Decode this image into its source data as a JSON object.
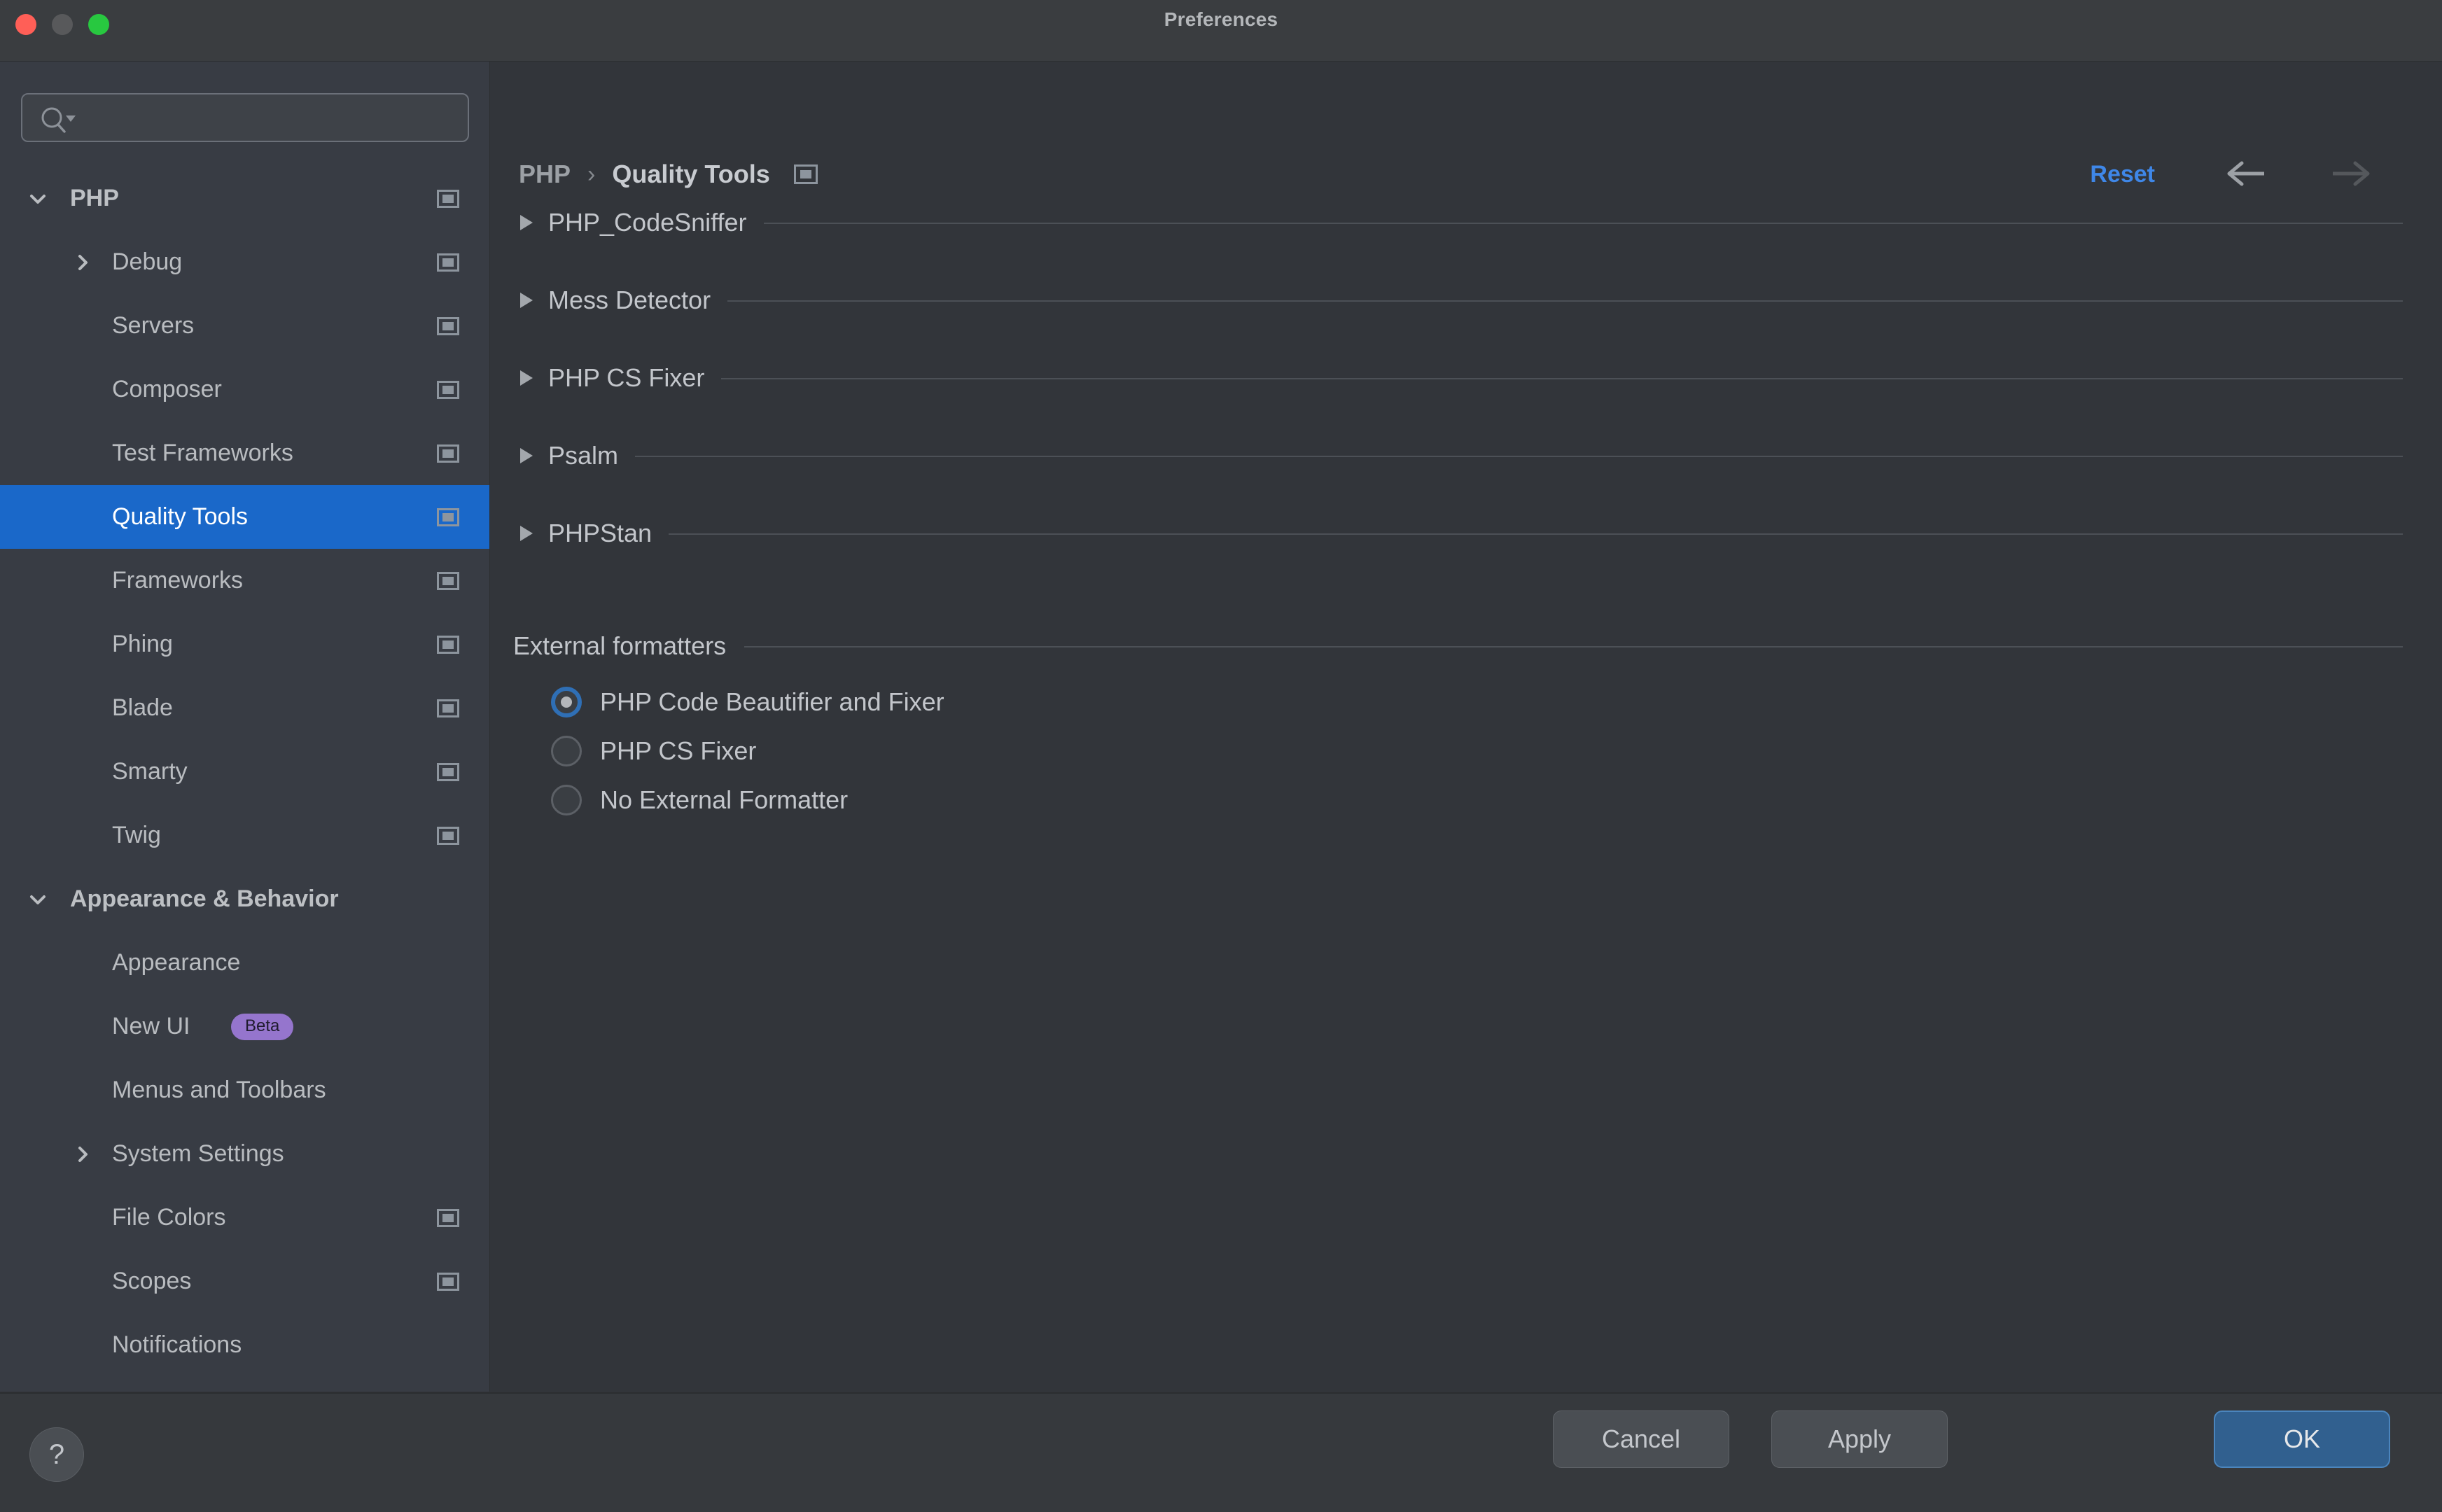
{
  "window": {
    "title": "Preferences",
    "traffic_lights": [
      "close-button",
      "minimize-button",
      "zoom-button"
    ]
  },
  "sidebar": {
    "search": {
      "value": "",
      "placeholder": "",
      "icon": "search-icon"
    },
    "items": [
      {
        "label": "PHP",
        "level": 0,
        "chevron": "chevron-down",
        "bold": true,
        "scope_icon": true,
        "selected": false
      },
      {
        "label": "Debug",
        "level": 1,
        "chevron": "chevron-right",
        "bold": false,
        "scope_icon": true,
        "selected": false
      },
      {
        "label": "Servers",
        "level": 1,
        "chevron": "none",
        "bold": false,
        "scope_icon": true,
        "selected": false
      },
      {
        "label": "Composer",
        "level": 1,
        "chevron": "none",
        "bold": false,
        "scope_icon": true,
        "selected": false
      },
      {
        "label": "Test Frameworks",
        "level": 1,
        "chevron": "none",
        "bold": false,
        "scope_icon": true,
        "selected": false
      },
      {
        "label": "Quality Tools",
        "level": 1,
        "chevron": "none",
        "bold": false,
        "scope_icon": true,
        "selected": true
      },
      {
        "label": "Frameworks",
        "level": 1,
        "chevron": "none",
        "bold": false,
        "scope_icon": true,
        "selected": false
      },
      {
        "label": "Phing",
        "level": 1,
        "chevron": "none",
        "bold": false,
        "scope_icon": true,
        "selected": false
      },
      {
        "label": "Blade",
        "level": 1,
        "chevron": "none",
        "bold": false,
        "scope_icon": true,
        "selected": false
      },
      {
        "label": "Smarty",
        "level": 1,
        "chevron": "none",
        "bold": false,
        "scope_icon": true,
        "selected": false
      },
      {
        "label": "Twig",
        "level": 1,
        "chevron": "none",
        "bold": false,
        "scope_icon": true,
        "selected": false
      },
      {
        "label": "Appearance & Behavior",
        "level": 0,
        "chevron": "chevron-down",
        "bold": true,
        "scope_icon": false,
        "selected": false
      },
      {
        "label": "Appearance",
        "level": 1,
        "chevron": "none",
        "bold": false,
        "scope_icon": false,
        "selected": false
      },
      {
        "label": "New UI",
        "level": 1,
        "chevron": "none",
        "bold": false,
        "scope_icon": false,
        "selected": false,
        "badge": "Beta"
      },
      {
        "label": "Menus and Toolbars",
        "level": 1,
        "chevron": "none",
        "bold": false,
        "scope_icon": false,
        "selected": false
      },
      {
        "label": "System Settings",
        "level": 1,
        "chevron": "chevron-right",
        "bold": false,
        "scope_icon": false,
        "selected": false
      },
      {
        "label": "File Colors",
        "level": 1,
        "chevron": "none",
        "bold": false,
        "scope_icon": true,
        "selected": false
      },
      {
        "label": "Scopes",
        "level": 1,
        "chevron": "none",
        "bold": false,
        "scope_icon": true,
        "selected": false
      },
      {
        "label": "Notifications",
        "level": 1,
        "chevron": "none",
        "bold": false,
        "scope_icon": false,
        "selected": false
      }
    ]
  },
  "header": {
    "breadcrumb_root": "PHP",
    "breadcrumb_separator": "›",
    "breadcrumb_current": "Quality Tools",
    "scope_icon": "project-scope-icon",
    "reset_label": "Reset",
    "back_icon": "arrow-left-icon",
    "forward_icon": "arrow-right-icon",
    "back_enabled": true,
    "forward_enabled": false
  },
  "main": {
    "sections": [
      {
        "label": "PHP_CodeSniffer",
        "expanded": false
      },
      {
        "label": "Mess Detector",
        "expanded": false
      },
      {
        "label": "PHP CS Fixer",
        "expanded": false
      },
      {
        "label": "Psalm",
        "expanded": false
      },
      {
        "label": "PHPStan",
        "expanded": false
      }
    ],
    "external_formatters": {
      "group_label": "External formatters",
      "options": [
        {
          "label": "PHP Code Beautifier and Fixer",
          "checked": true
        },
        {
          "label": "PHP CS Fixer",
          "checked": false
        },
        {
          "label": "No External Formatter",
          "checked": false
        }
      ]
    }
  },
  "footer": {
    "help_label": "?",
    "cancel_label": "Cancel",
    "apply_label": "Apply",
    "ok_label": "OK"
  },
  "colors": {
    "accent_selection": "#1a68c9",
    "accent_link": "#3f87e8",
    "accent_default_button": "#31608f",
    "badge_beta": "#9575cd",
    "sidebar_bg": "#383c44",
    "main_bg": "#32353a",
    "titlebar_bg": "#3a3d40"
  }
}
